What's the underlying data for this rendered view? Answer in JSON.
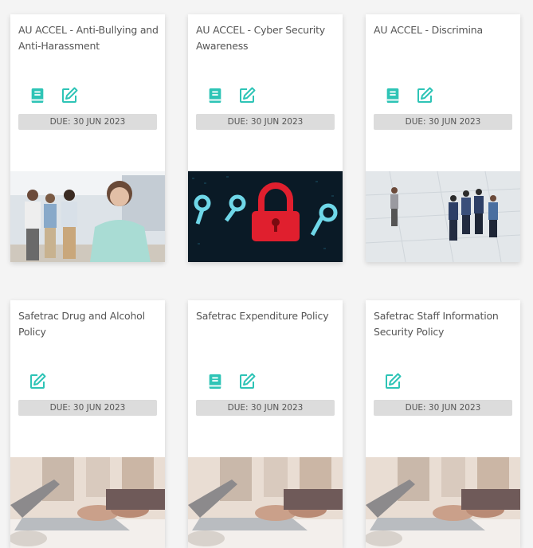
{
  "accent_color": "#2ec4b6",
  "cards": [
    {
      "title": "AU ACCEL - Anti-Bullying and Anti-Harassment",
      "due": "DUE: 30 JUN 2023",
      "icons": [
        "book-icon",
        "edit-icon"
      ],
      "image": "office-people-photo"
    },
    {
      "title": "AU ACCEL - Cyber Security Awareness",
      "due": "DUE: 30 JUN 2023",
      "icons": [
        "book-icon",
        "edit-icon"
      ],
      "image": "padlock-keys-photo"
    },
    {
      "title": "AU ACCEL - Discrimina",
      "due": "DUE: 30 JUN 2023",
      "icons": [
        "book-icon",
        "edit-icon"
      ],
      "image": "business-people-floor-photo"
    },
    {
      "title": "Safetrac Drug and Alcohol Policy",
      "due": "DUE: 30 JUN 2023",
      "icons": [
        "edit-icon"
      ],
      "image": "laptop-typing-photo"
    },
    {
      "title": "Safetrac Expenditure Policy",
      "due": "DUE: 30 JUN 2023",
      "icons": [
        "book-icon",
        "edit-icon"
      ],
      "image": "laptop-typing-photo"
    },
    {
      "title": "Safetrac Staff Information Security Policy",
      "due": "DUE: 30 JUN 2023",
      "icons": [
        "edit-icon"
      ],
      "image": "laptop-typing-photo"
    }
  ]
}
